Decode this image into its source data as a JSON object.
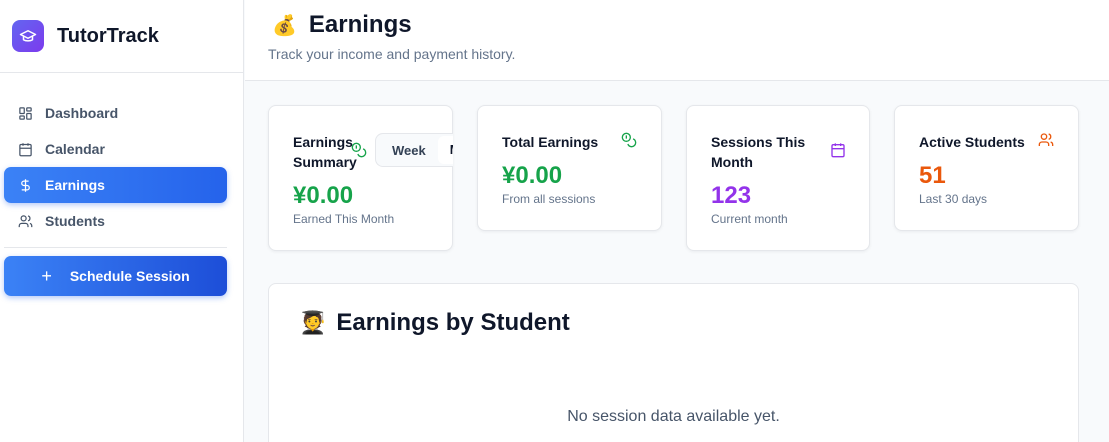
{
  "app": {
    "name": "TutorTrack",
    "logo_icon": "graduation-cap-icon"
  },
  "sidebar": {
    "items": [
      {
        "label": "Dashboard",
        "icon": "dashboard-icon",
        "active": false
      },
      {
        "label": "Calendar",
        "icon": "calendar-icon",
        "active": false
      },
      {
        "label": "Earnings",
        "icon": "dollar-icon",
        "active": true
      },
      {
        "label": "Students",
        "icon": "users-icon",
        "active": false
      }
    ],
    "schedule_button": "Schedule Session"
  },
  "header": {
    "emoji": "💰",
    "title": "Earnings",
    "subtitle": "Track your income and payment history."
  },
  "cards": {
    "summary": {
      "title": "Earnings Summary",
      "value": "¥0.00",
      "caption": "Earned This Month",
      "color": "#16a34a",
      "toggle": {
        "options": [
          "Week",
          "Mont"
        ],
        "selected": "Mont"
      }
    },
    "total": {
      "title": "Total Earnings",
      "value": "¥0.00",
      "caption": "From all sessions",
      "color": "#16a34a"
    },
    "sessions": {
      "title": "Sessions This Month",
      "value": "123",
      "caption": "Current month",
      "color": "#9333ea"
    },
    "students": {
      "title": "Active Students",
      "value": "51",
      "caption": "Last 30 days",
      "color": "#ea580c"
    }
  },
  "by_student": {
    "emoji": "🧑‍🎓",
    "title": "Earnings by Student",
    "empty_message": "No session data available yet."
  },
  "colors": {
    "accent": "#2563eb",
    "green": "#16a34a",
    "purple": "#9333ea",
    "orange": "#ea580c"
  }
}
